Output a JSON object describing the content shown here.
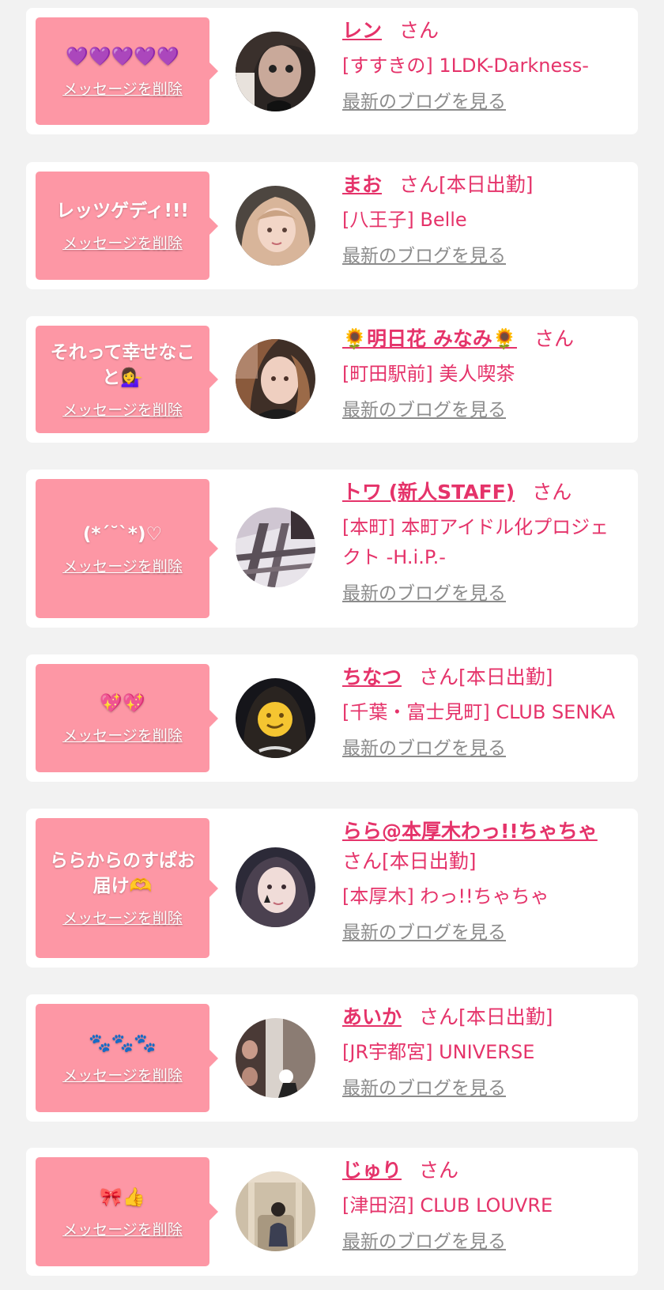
{
  "items": [
    {
      "message": "💜💜💜💜💜",
      "delete_label": "メッセージを削除",
      "name": "レン",
      "suffix": "さん",
      "shop": "[すすきの] 1LDK-Darkness-",
      "blog_label": "最新のブログを見る"
    },
    {
      "message": "レッツゲディ!!!",
      "delete_label": "メッセージを削除",
      "name": "まお",
      "suffix": "さん[本日出勤]",
      "shop": "[八王子] Belle",
      "blog_label": "最新のブログを見る"
    },
    {
      "message": "それって幸せなこと💁‍♀️",
      "delete_label": "メッセージを削除",
      "name": "🌻明日花 みなみ🌻",
      "suffix": "さん",
      "shop": "[町田駅前] 美人喫茶",
      "blog_label": "最新のブログを見る"
    },
    {
      "message": "(*´˘`*)♡",
      "delete_label": "メッセージを削除",
      "name": "トワ (新人STAFF)",
      "suffix": "さん",
      "shop": "[本町] 本町アイドル化プロジェクト -H.i.P.-",
      "blog_label": "最新のブログを見る"
    },
    {
      "message": "💖💖",
      "delete_label": "メッセージを削除",
      "name": "ちなつ",
      "suffix": "さん[本日出勤]",
      "shop": "[千葉・富士見町] CLUB SENKA",
      "blog_label": "最新のブログを見る"
    },
    {
      "message": "ららからのすぱお届け🫶",
      "delete_label": "メッセージを削除",
      "name": "らら@本厚木わっ!!ちゃちゃ",
      "suffix": "さん[本日出勤]",
      "shop": "[本厚木] わっ!!ちゃちゃ",
      "blog_label": "最新のブログを見る"
    },
    {
      "message": "🐾🐾🐾",
      "delete_label": "メッセージを削除",
      "name": "あいか",
      "suffix": "さん[本日出勤]",
      "shop": "[JR宇都宮] UNIVERSE",
      "blog_label": "最新のブログを見る"
    },
    {
      "message": "🎀👍",
      "delete_label": "メッセージを削除",
      "name": "じゅり",
      "suffix": "さん",
      "shop": "[津田沼] CLUB LOUVRE",
      "blog_label": "最新のブログを見る"
    }
  ]
}
